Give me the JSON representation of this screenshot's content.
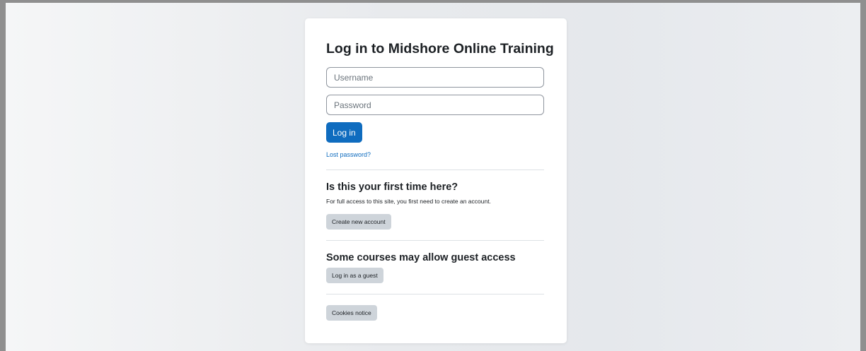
{
  "login": {
    "title": "Log in to Midshore Online Training",
    "username_placeholder": "Username",
    "password_placeholder": "Password",
    "login_button": "Log in",
    "lost_password": "Lost password?"
  },
  "signup": {
    "heading": "Is this your first time here?",
    "text": "For full access to this site, you first need to create an account.",
    "button": "Create new account"
  },
  "guest": {
    "heading": "Some courses may allow guest access",
    "button": "Log in as a guest"
  },
  "footer": {
    "cookies_button": "Cookies notice"
  },
  "colors": {
    "primary": "#0f6cbf",
    "secondary_button": "#ced4da",
    "text": "#1d2125",
    "border": "#8f959e"
  }
}
